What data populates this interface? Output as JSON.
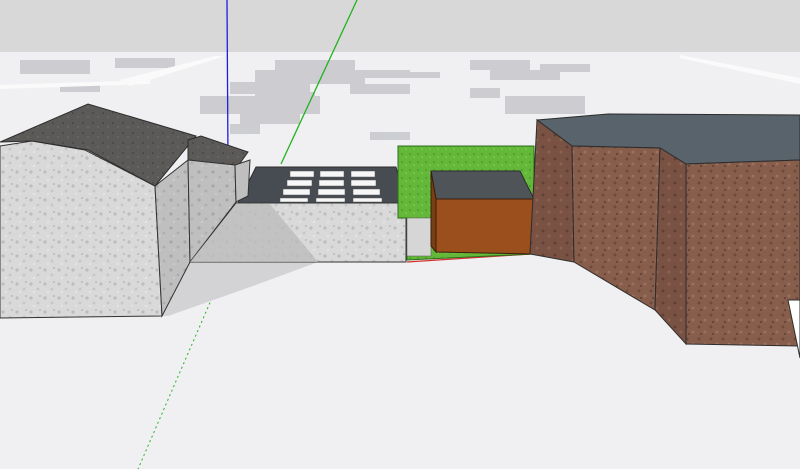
{
  "viewport": {
    "sky_color": "#d8d8d8",
    "ground_color": "#f0f0f2",
    "ground_shadow_color": "#c7c8cc",
    "axis_colors": {
      "red": "#d63030",
      "green": "#1fb31f",
      "blue": "#1d1de0"
    }
  },
  "models": {
    "gray_house": {
      "wall_color": "#d9d9d9",
      "roof_color": "#5c5a58"
    },
    "low_extension": {
      "wall_color": "#d4d4d4",
      "roof_color": "#474c52",
      "skylight_color": "#f7f7f7"
    },
    "hedge": {
      "color": "#63b839"
    },
    "garage": {
      "roof_color": "#4f5459",
      "wall_color": "#9a4f1c"
    },
    "brick_building": {
      "roof_color": "#59636b",
      "wall_color": "#875d4c"
    }
  }
}
